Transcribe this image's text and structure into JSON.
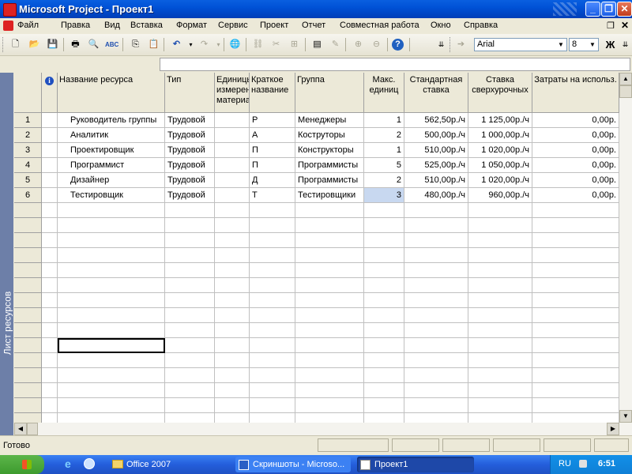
{
  "window": {
    "title": "Microsoft Project - Проект1"
  },
  "menu": [
    "Файл",
    "Правка",
    "Вид",
    "Вставка",
    "Формат",
    "Сервис",
    "Проект",
    "Отчет",
    "Совместная работа",
    "Окно",
    "Справка"
  ],
  "toolbar": {
    "font": "Arial",
    "size": "8",
    "bold_label": "Ж"
  },
  "view_label": "Лист ресурсов",
  "columns": {
    "info_icon": "i",
    "name": "Название ресурса",
    "type": "Тип",
    "units": "Единицы измерения материалов",
    "initials": "Краткое название",
    "group": "Группа",
    "max": "Макс. единиц",
    "std": "Стандартная ставка",
    "ovt": "Ставка сверхурочных",
    "cost": "Затраты на использ."
  },
  "rows": [
    {
      "id": "1",
      "name": "Руководитель группы",
      "type": "Трудовой",
      "units": "",
      "initials": "Р",
      "group": "Менеджеры",
      "max": "1",
      "std": "562,50р./ч",
      "ovt": "1 125,00р./ч",
      "cost": "0,00р."
    },
    {
      "id": "2",
      "name": "Аналитик",
      "type": "Трудовой",
      "units": "",
      "initials": "А",
      "group": "Коструторы",
      "max": "2",
      "std": "500,00р./ч",
      "ovt": "1 000,00р./ч",
      "cost": "0,00р."
    },
    {
      "id": "3",
      "name": "Проектировщик",
      "type": "Трудовой",
      "units": "",
      "initials": "П",
      "group": "Конструкторы",
      "max": "1",
      "std": "510,00р./ч",
      "ovt": "1 020,00р./ч",
      "cost": "0,00р."
    },
    {
      "id": "4",
      "name": "Программист",
      "type": "Трудовой",
      "units": "",
      "initials": "П",
      "group": "Программисты",
      "max": "5",
      "std": "525,00р./ч",
      "ovt": "1 050,00р./ч",
      "cost": "0,00р."
    },
    {
      "id": "5",
      "name": "Дизайнер",
      "type": "Трудовой",
      "units": "",
      "initials": "Д",
      "group": "Программисты",
      "max": "2",
      "std": "510,00р./ч",
      "ovt": "1 020,00р./ч",
      "cost": "0,00р."
    },
    {
      "id": "6",
      "name": "Тестировщик",
      "type": "Трудовой",
      "units": "",
      "initials": "Т",
      "group": "Тестировщики",
      "max": "3",
      "std": "480,00р./ч",
      "ovt": "960,00р./ч",
      "cost": "0,00р."
    }
  ],
  "status": {
    "text": "Готово"
  },
  "taskbar": {
    "items": [
      "Office 2007",
      "Скриншоты - Microso...",
      "Проект1"
    ],
    "lang": "RU",
    "clock": "6:51"
  },
  "colors": {
    "titlebar": "#0054e3",
    "viewbar": "#6d7fa8",
    "selected_cell": "#c8d8f0",
    "taskbar": "#245edb"
  }
}
